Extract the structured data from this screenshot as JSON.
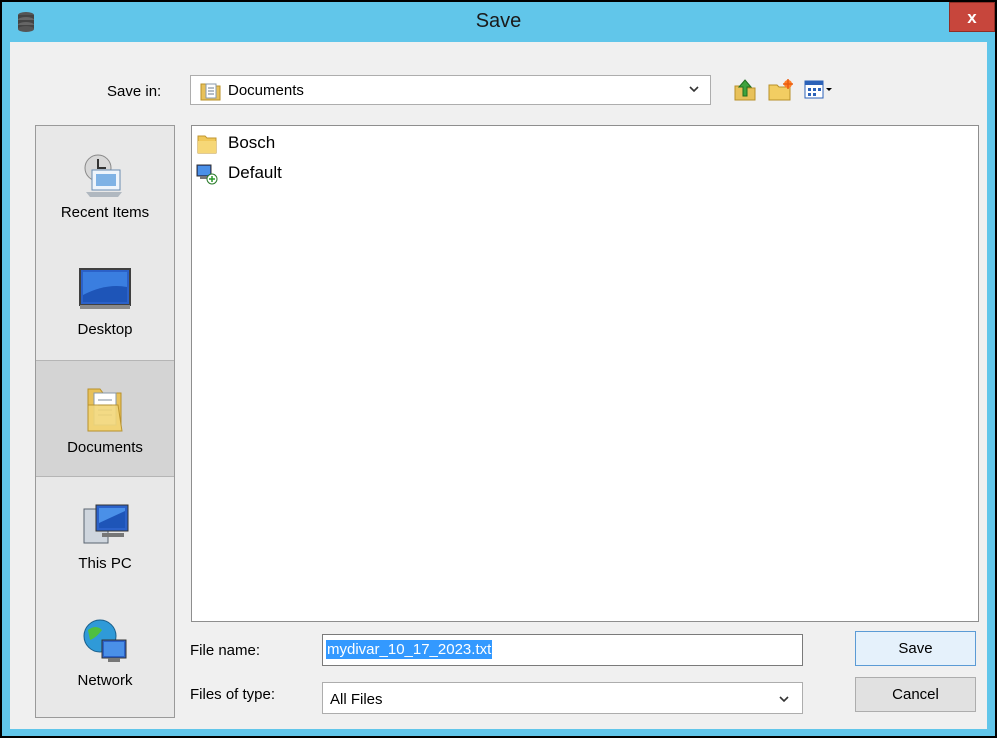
{
  "window": {
    "title": "Save",
    "close_label": "x"
  },
  "save_in": {
    "label": "Save in:",
    "value": "Documents"
  },
  "places": [
    {
      "label": "Recent Items",
      "icon": "recent-items-icon"
    },
    {
      "label": "Desktop",
      "icon": "desktop-icon"
    },
    {
      "label": "Documents",
      "icon": "documents-icon",
      "selected": true
    },
    {
      "label": "This PC",
      "icon": "this-pc-icon"
    },
    {
      "label": "Network",
      "icon": "network-icon"
    }
  ],
  "files": [
    {
      "name": "Bosch",
      "icon": "folder-icon"
    },
    {
      "name": "Default",
      "icon": "shortcut-icon"
    }
  ],
  "form": {
    "file_name_label": "File name:",
    "file_name_value": "mydivar_10_17_2023.txt",
    "file_type_label": "Files of type:",
    "file_type_value": "All Files"
  },
  "buttons": {
    "save": "Save",
    "cancel": "Cancel"
  },
  "colors": {
    "titlebar": "#61c6ea",
    "close": "#c7463c",
    "selection": "#3399ff"
  }
}
